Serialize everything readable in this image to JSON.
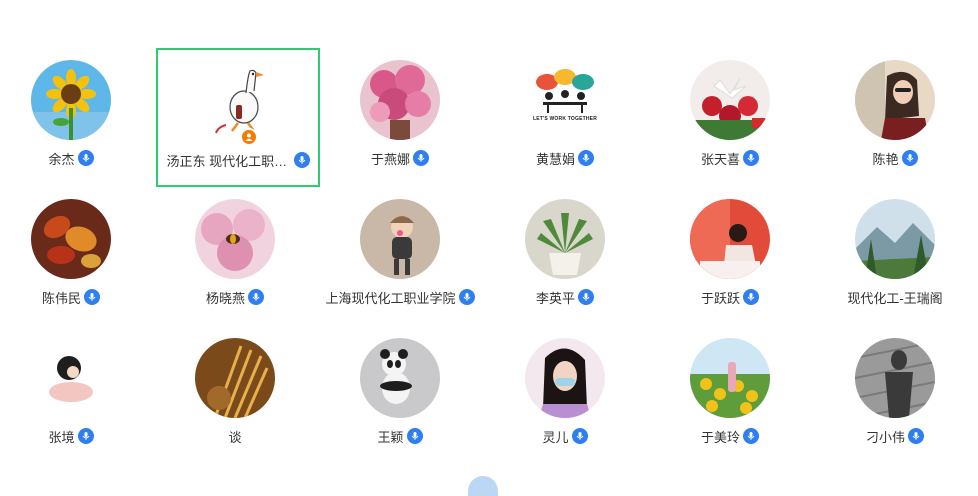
{
  "participants": [
    {
      "name": "余杰",
      "avatar": "sunflower-avatar",
      "mic": true
    },
    {
      "name": "汤正东 现代化工职业学院",
      "avatar": "goose-avatar",
      "mic": true,
      "selected": true,
      "host": true
    },
    {
      "name": "于燕娜",
      "avatar": "pink-flowers-avatar",
      "mic": true
    },
    {
      "name": "黄慧娟",
      "avatar": "lets-work-together-avatar",
      "mic": true,
      "avatar_text": "LET'S WORK TOGETHER"
    },
    {
      "name": "张天喜",
      "avatar": "lily-bouquet-avatar",
      "mic": true
    },
    {
      "name": "陈艳",
      "avatar": "woman-sunglasses-avatar",
      "mic": true
    },
    {
      "name": "陈伟民",
      "avatar": "autumn-leaves-avatar",
      "mic": true
    },
    {
      "name": "杨晓燕",
      "avatar": "pink-blossom-bee-avatar",
      "mic": true
    },
    {
      "name": "上海现代化工职业学院",
      "avatar": "toddler-avatar",
      "mic": true
    },
    {
      "name": "李英平",
      "avatar": "potted-succulent-avatar",
      "mic": true
    },
    {
      "name": "于跃跃",
      "avatar": "woman-writing-avatar",
      "mic": true
    },
    {
      "name": "现代化工-王瑞阁",
      "avatar": "mountain-landscape-avatar",
      "mic": false
    },
    {
      "name": "张境",
      "avatar": "sketch-girl-avatar",
      "mic": true
    },
    {
      "name": "谈",
      "avatar": "wheat-avatar",
      "mic": false
    },
    {
      "name": "王颖",
      "avatar": "panda-toy-avatar",
      "mic": true
    },
    {
      "name": "灵儿",
      "avatar": "girl-selfie-avatar",
      "mic": true
    },
    {
      "name": "于美玲",
      "avatar": "yellow-flowers-avatar",
      "mic": true
    },
    {
      "name": "刁小伟",
      "avatar": "shadow-avatar",
      "mic": true
    }
  ],
  "colors": {
    "mic_badge": "#2f7ff0",
    "selected_border": "#2ecc71",
    "host_badge": "#f57c00"
  }
}
